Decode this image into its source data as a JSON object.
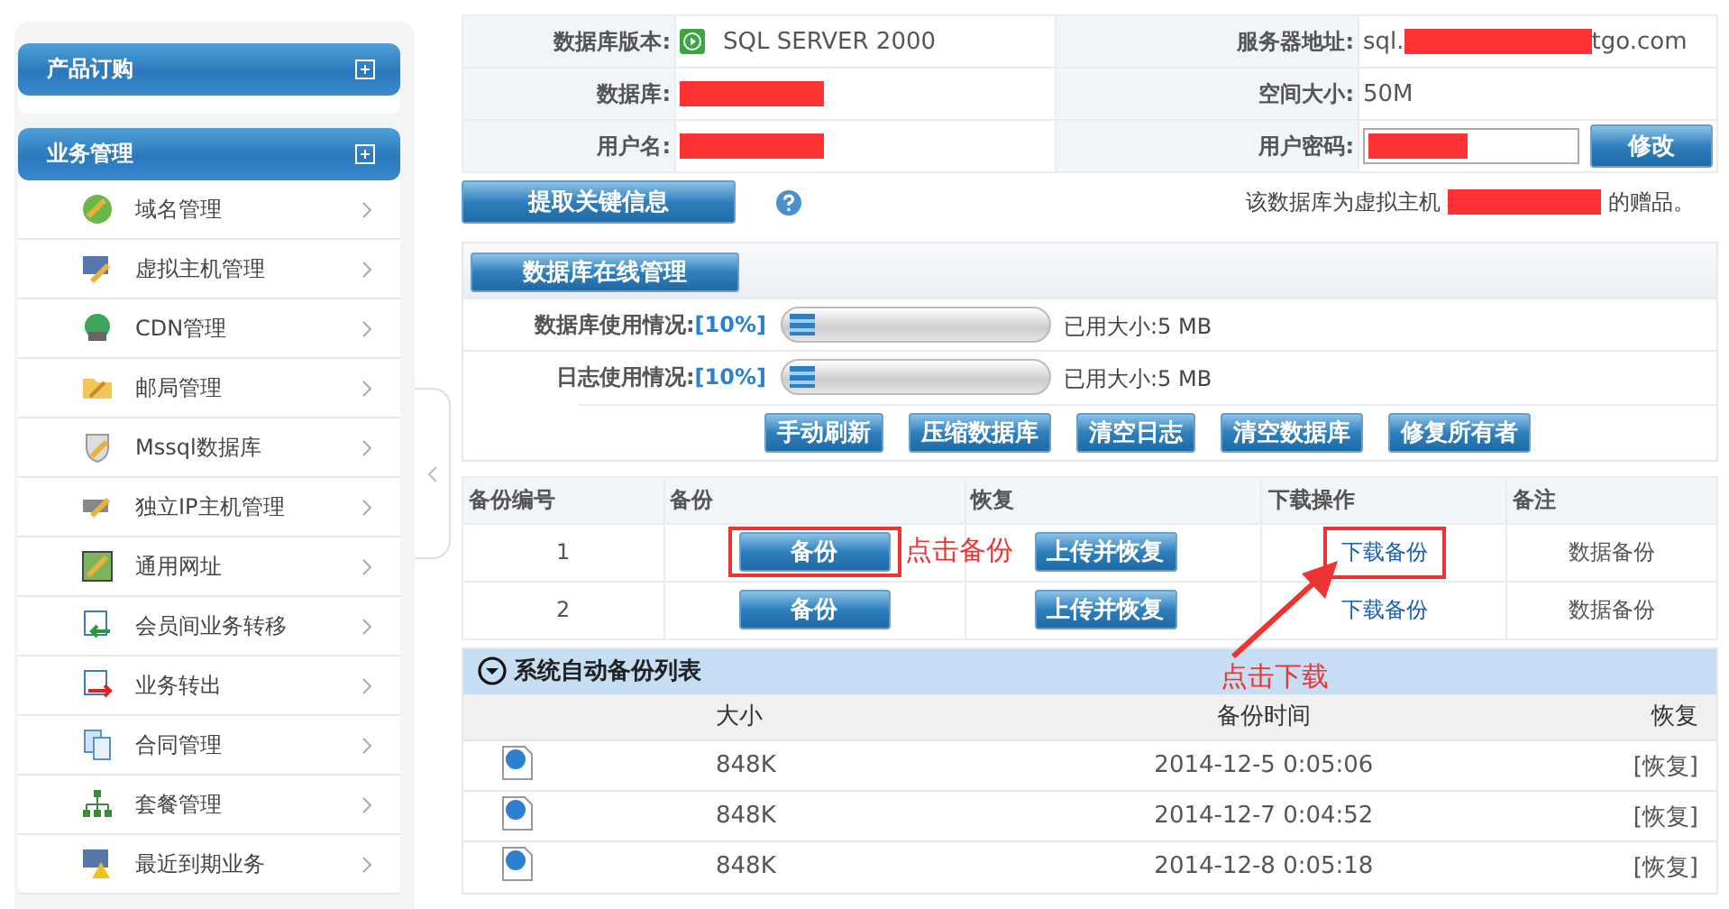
{
  "sidebar": {
    "sections": [
      {
        "title": "产品订购"
      },
      {
        "title": "业务管理",
        "items": [
          {
            "label": "域名管理"
          },
          {
            "label": "虚拟主机管理"
          },
          {
            "label": "CDN管理"
          },
          {
            "label": "邮局管理"
          },
          {
            "label": "Mssql数据库"
          },
          {
            "label": "独立IP主机管理"
          },
          {
            "label": "通用网址"
          },
          {
            "label": "会员间业务转移"
          },
          {
            "label": "业务转出"
          },
          {
            "label": "合同管理"
          },
          {
            "label": "套餐管理"
          },
          {
            "label": "最近到期业务"
          }
        ]
      }
    ]
  },
  "info": {
    "version_label": "数据库版本:",
    "version": "SQL SERVER 2000",
    "server_label": "服务器地址:",
    "server_prefix": "sql.",
    "server_suffix": "tgo.com",
    "db_label": "数据库:",
    "size_label": "空间大小:",
    "size": "50M",
    "user_label": "用户名:",
    "password_label": "用户密码:",
    "modify_button": "修改"
  },
  "extract_button": "提取关键信息",
  "gift_prefix": "该数据库为虚拟主机",
  "gift_suffix": "的赠品。",
  "online": {
    "title": "数据库在线管理",
    "usage": [
      {
        "label": "数据库使用情况:",
        "percent": "[10%]",
        "level": 0.1,
        "used": "已用大小:5 MB"
      },
      {
        "label": "日志使用情况:",
        "percent": "[10%]",
        "level": 0.1,
        "used": "已用大小:5 MB"
      }
    ],
    "buttons": [
      "手动刷新",
      "压缩数据库",
      "清空日志",
      "清空数据库",
      "修复所有者"
    ]
  },
  "backups": {
    "columns": [
      "备份编号",
      "备份",
      "恢复",
      "下载操作",
      "备注"
    ],
    "rows": [
      {
        "number": "1",
        "backup_button": "备份",
        "restore_button": "上传并恢复",
        "download": "下载备份",
        "note": "数据备份",
        "highlighted": true
      },
      {
        "number": "2",
        "backup_button": "备份",
        "restore_button": "上传并恢复",
        "download": "下载备份",
        "note": "数据备份",
        "highlighted": false
      }
    ]
  },
  "auto_list": {
    "title": "系统自动备份列表",
    "columns": [
      "大小",
      "备份时间",
      "恢复"
    ],
    "rows": [
      {
        "size": "848K",
        "time": "2014-12-5 0:05:06",
        "restore": "[恢复]"
      },
      {
        "size": "848K",
        "time": "2014-12-7 0:04:52",
        "restore": "[恢复]"
      },
      {
        "size": "848K",
        "time": "2014-12-8 0:05:18",
        "restore": "[恢复]"
      }
    ]
  },
  "annotations": [
    {
      "text": "点击备份"
    },
    {
      "text": "点击下载"
    }
  ]
}
